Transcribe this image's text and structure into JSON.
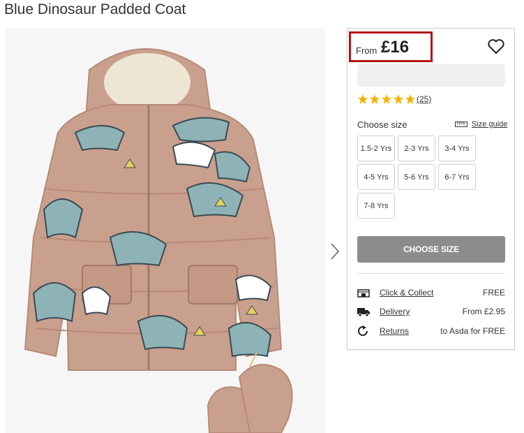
{
  "product": {
    "title": "Blue Dinosaur Padded Coat"
  },
  "price": {
    "from_label": "From",
    "value": "£16"
  },
  "rating": {
    "stars": 5,
    "max": 5,
    "star_color": "#f5b400",
    "reviews": "(25)"
  },
  "sizes": {
    "label": "Choose size",
    "guide_label": "Size guide",
    "options": [
      "1.5-2 Yrs",
      "2-3 Yrs",
      "3-4 Yrs",
      "4-5 Yrs",
      "5-6 Yrs",
      "6-7 Yrs",
      "7-8 Yrs"
    ]
  },
  "cta": {
    "label": "CHOOSE SIZE"
  },
  "delivery": [
    {
      "icon": "store-icon",
      "label": "Click & Collect",
      "value": "FREE"
    },
    {
      "icon": "truck-icon",
      "label": "Delivery",
      "value": "From £2.95"
    },
    {
      "icon": "returns-icon",
      "label": "Returns",
      "value": "to Asda for FREE"
    }
  ],
  "colors": {
    "price_highlight": "#b41414",
    "cta_bg": "#8c8c8c",
    "coat": "#c9a08d",
    "dino": "#8eb3b6"
  }
}
